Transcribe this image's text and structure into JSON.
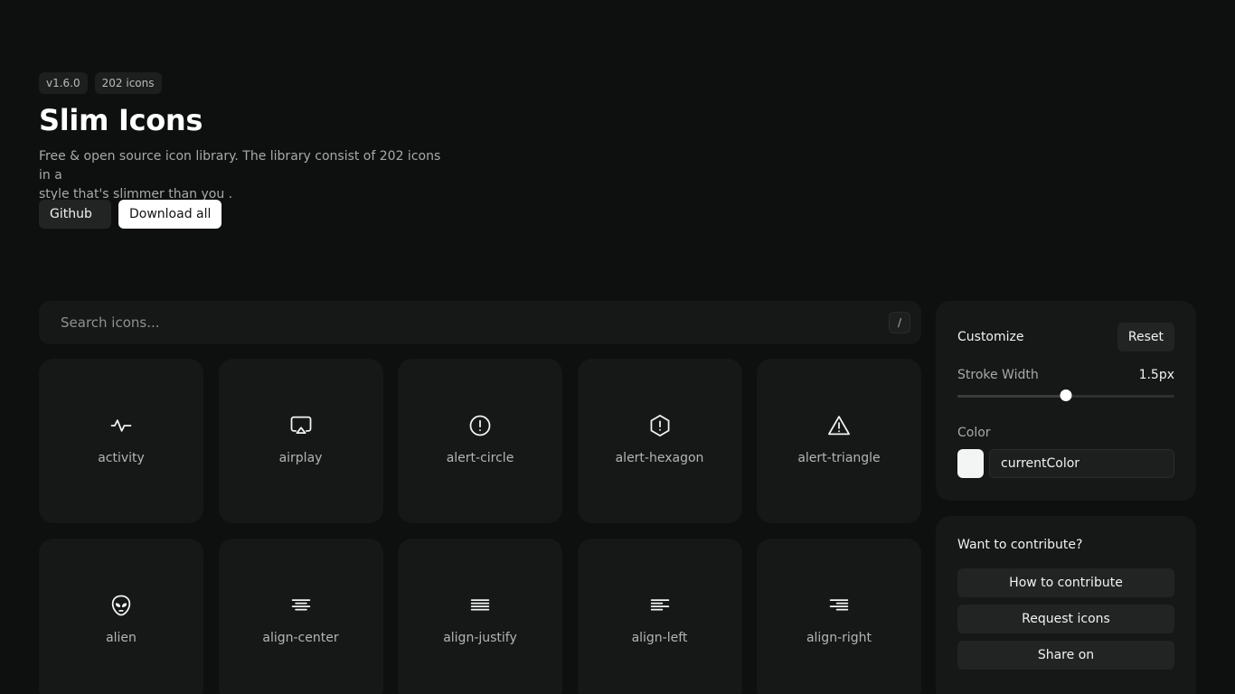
{
  "hero": {
    "version_badge": "v1.6.0",
    "count_badge": "202 icons",
    "title": "Slim Icons",
    "description_line1": "Free & open source icon library. The library consist of 202 icons in a",
    "description_line2": "style that's slimmer than you   .",
    "github_label": "Github",
    "download_label": "Download all"
  },
  "search": {
    "placeholder": "Search icons...",
    "shortcut": "/"
  },
  "icons": [
    {
      "label": "activity",
      "icon": "activity-icon"
    },
    {
      "label": "airplay",
      "icon": "airplay-icon"
    },
    {
      "label": "alert-circle",
      "icon": "alert-circle-icon"
    },
    {
      "label": "alert-hexagon",
      "icon": "alert-hexagon-icon"
    },
    {
      "label": "alert-triangle",
      "icon": "alert-triangle-icon"
    },
    {
      "label": "alien",
      "icon": "alien-icon"
    },
    {
      "label": "align-center",
      "icon": "align-center-icon"
    },
    {
      "label": "align-justify",
      "icon": "align-justify-icon"
    },
    {
      "label": "align-left",
      "icon": "align-left-icon"
    },
    {
      "label": "align-right",
      "icon": "align-right-icon"
    }
  ],
  "customize": {
    "title": "Customize",
    "reset_label": "Reset",
    "stroke_label": "Stroke Width",
    "stroke_value": "1.5px",
    "stroke_fraction": 0.5,
    "color_label": "Color",
    "color_value": "currentColor",
    "swatch_color": "#f3f5f4"
  },
  "contribute": {
    "title": "Want to contribute?",
    "how_label": "How to contribute",
    "request_label": "Request icons",
    "share_label": "Share on"
  },
  "colors": {
    "background": "#0e0f0f",
    "card": "#161717",
    "accent": "#ffffff"
  }
}
